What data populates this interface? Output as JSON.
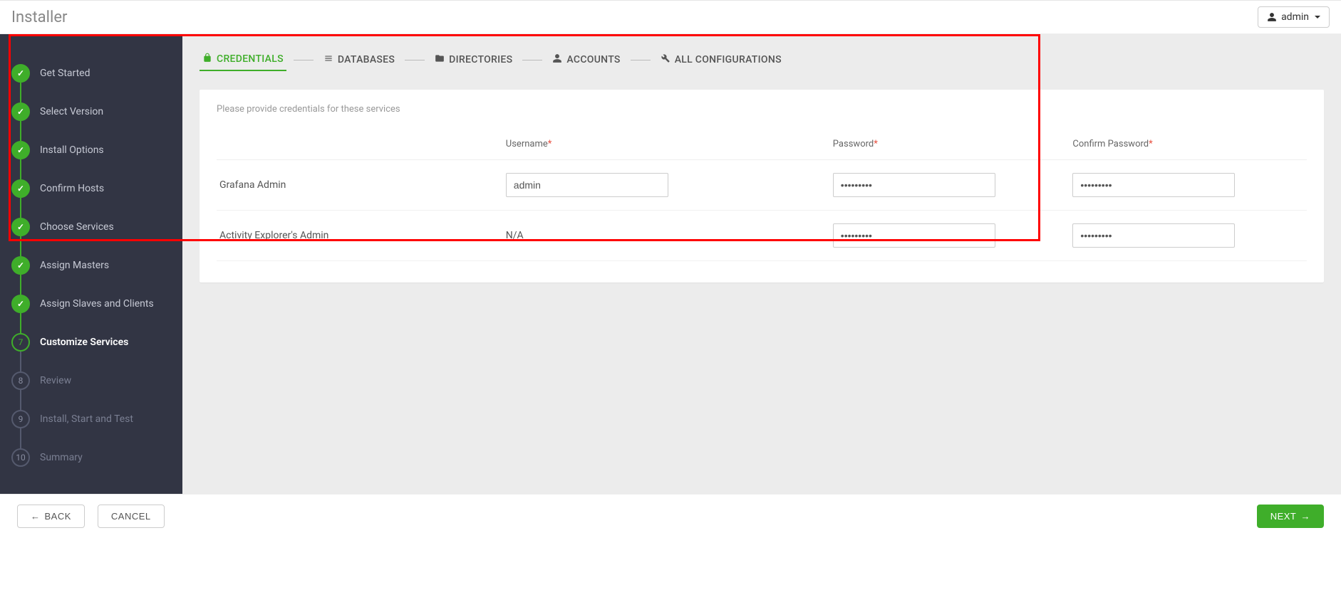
{
  "header": {
    "title": "Installer",
    "user_label": "admin"
  },
  "sidebar": {
    "steps": [
      {
        "label": "Get Started",
        "state": "completed",
        "num": "✓"
      },
      {
        "label": "Select Version",
        "state": "completed",
        "num": "✓"
      },
      {
        "label": "Install Options",
        "state": "completed",
        "num": "✓"
      },
      {
        "label": "Confirm Hosts",
        "state": "completed",
        "num": "✓"
      },
      {
        "label": "Choose Services",
        "state": "completed",
        "num": "✓"
      },
      {
        "label": "Assign Masters",
        "state": "completed",
        "num": "✓"
      },
      {
        "label": "Assign Slaves and Clients",
        "state": "completed",
        "num": "✓"
      },
      {
        "label": "Customize Services",
        "state": "current",
        "num": "7"
      },
      {
        "label": "Review",
        "state": "pending",
        "num": "8"
      },
      {
        "label": "Install, Start and Test",
        "state": "pending",
        "num": "9"
      },
      {
        "label": "Summary",
        "state": "pending",
        "num": "10"
      }
    ]
  },
  "tabs": {
    "items": [
      {
        "label": "CREDENTIALS",
        "icon": "lock-icon",
        "active": true
      },
      {
        "label": "DATABASES",
        "icon": "list-icon",
        "active": false
      },
      {
        "label": "DIRECTORIES",
        "icon": "folder-icon",
        "active": false
      },
      {
        "label": "ACCOUNTS",
        "icon": "user-icon",
        "active": false
      },
      {
        "label": "ALL CONFIGURATIONS",
        "icon": "wrench-icon",
        "active": false
      }
    ]
  },
  "panel": {
    "description": "Please provide credentials for these services",
    "columns": {
      "service": "",
      "username": "Username",
      "password": "Password",
      "confirm": "Confirm Password"
    },
    "rows": [
      {
        "service": "Grafana Admin",
        "username_value": "admin",
        "username_na": false,
        "password_value": "•••••••••",
        "confirm_value": "•••••••••"
      },
      {
        "service": "Activity Explorer's Admin",
        "username_value": "N/A",
        "username_na": true,
        "password_value": "•••••••••",
        "confirm_value": "•••••••••"
      }
    ]
  },
  "footer": {
    "back": "BACK",
    "cancel": "CANCEL",
    "next": "NEXT"
  },
  "highlight": {
    "visible": true
  }
}
